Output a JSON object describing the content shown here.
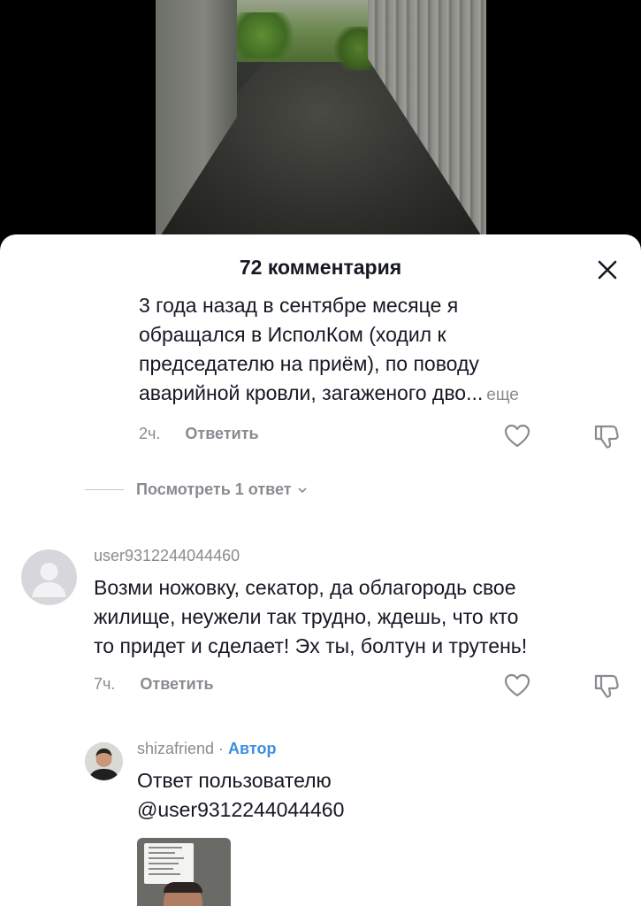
{
  "header": {
    "title": "72 комментария"
  },
  "comment_1": {
    "text_lines": [
      "3 года назад в сентябре месяце я",
      "обращался в ИсполКом (ходил к",
      "председателю на приём), по поводу",
      "аварийной кровли, загаженого дво..."
    ],
    "more_label": "еще",
    "time": "2ч.",
    "reply_label": "Ответить"
  },
  "view_replies": {
    "label": "Посмотреть 1 ответ"
  },
  "comment_2": {
    "username": "user9312244044460",
    "text_lines": [
      "Возми ножовку, секатор, да облагородь свое",
      "жилище, неужели так трудно, ждешь, что кто",
      "то придет и сделает! Эх ты, болтун и трутень!"
    ],
    "time": "7ч.",
    "reply_label": "Ответить"
  },
  "reply_1": {
    "username": "shizafriend",
    "separator": " · ",
    "author_badge": "Автор",
    "text_lines": [
      "Ответ пользователю",
      "@user9312244044460"
    ]
  },
  "icons": {
    "close": "close-icon",
    "like": "heart-outline-icon",
    "dislike": "thumbs-down-outline-icon",
    "chevron": "chevron-down-icon"
  },
  "colors": {
    "author_badge": "#3c8ee0",
    "secondary_text": "#8a8b91",
    "primary_text": "#161823"
  }
}
